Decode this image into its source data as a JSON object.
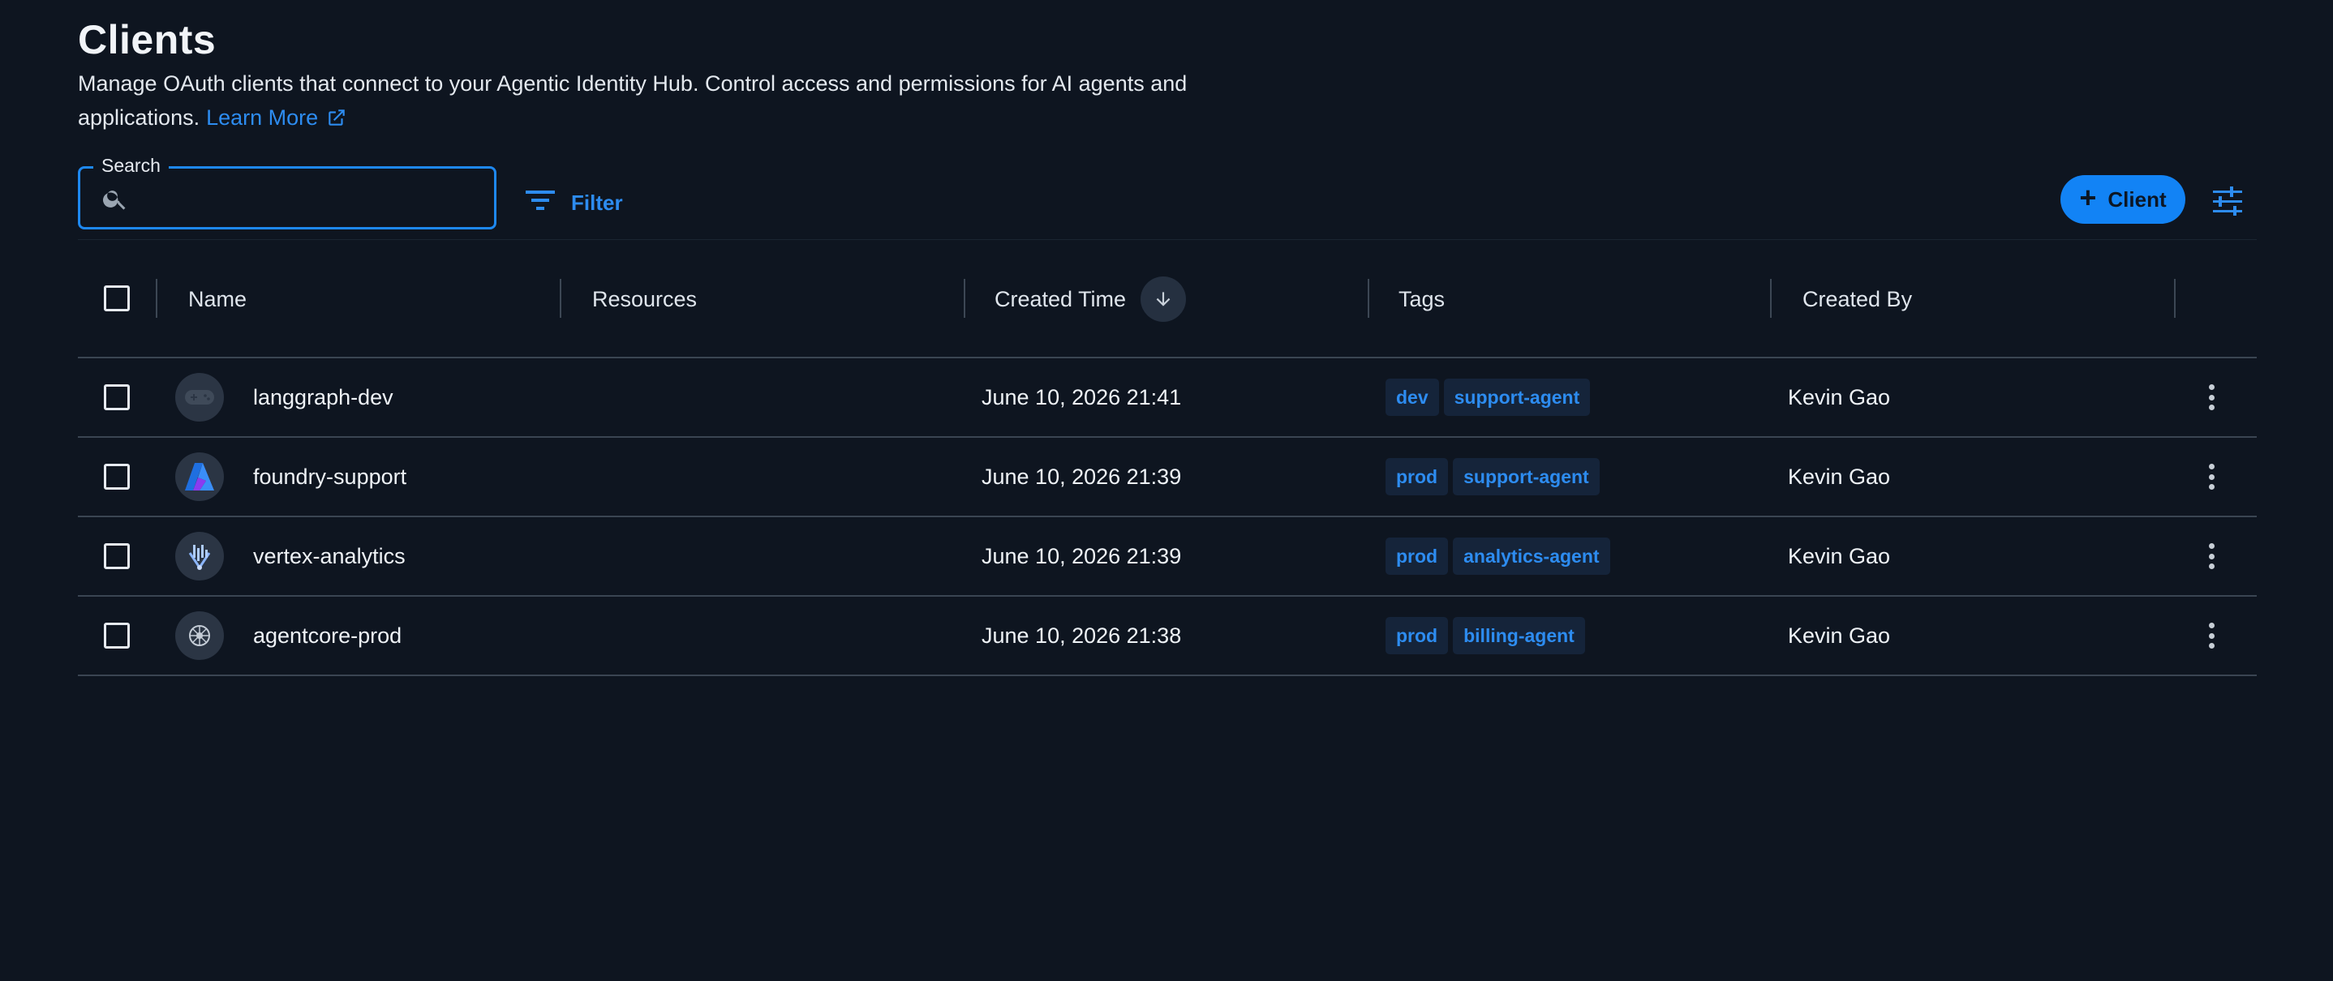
{
  "header": {
    "title": "Clients",
    "description": "Manage OAuth clients that connect to your Agentic Identity Hub. Control access and permissions for AI agents and applications.",
    "learn_more": "Learn More"
  },
  "toolbar": {
    "search_label": "Search",
    "search_value": "",
    "filter_label": "Filter",
    "add_client_label": "Client"
  },
  "table": {
    "columns": {
      "name": "Name",
      "resources": "Resources",
      "created_time": "Created Time",
      "tags": "Tags",
      "created_by": "Created By"
    },
    "sort": {
      "column": "created_time",
      "direction": "descending"
    },
    "rows": [
      {
        "name": "langgraph-dev",
        "avatar_icon": "gamepad-icon",
        "resources": "",
        "created_time": "June 10, 2026 21:41",
        "tags": [
          "dev",
          "support-agent"
        ],
        "created_by": "Kevin Gao"
      },
      {
        "name": "foundry-support",
        "avatar_icon": "azure-logo-icon",
        "resources": "",
        "created_time": "June 10, 2026 21:39",
        "tags": [
          "prod",
          "support-agent"
        ],
        "created_by": "Kevin Gao"
      },
      {
        "name": "vertex-analytics",
        "avatar_icon": "vertex-logo-icon",
        "resources": "",
        "created_time": "June 10, 2026 21:39",
        "tags": [
          "prod",
          "analytics-agent"
        ],
        "created_by": "Kevin Gao"
      },
      {
        "name": "agentcore-prod",
        "avatar_icon": "brain-icon",
        "resources": "",
        "created_time": "June 10, 2026 21:38",
        "tags": [
          "prod",
          "billing-agent"
        ],
        "created_by": "Kevin Gao"
      }
    ]
  },
  "colors": {
    "background": "#0e1520",
    "accent": "#1283f5",
    "link": "#2d8cf0",
    "tag_background": "#15243a",
    "divider": "#3a4552"
  }
}
